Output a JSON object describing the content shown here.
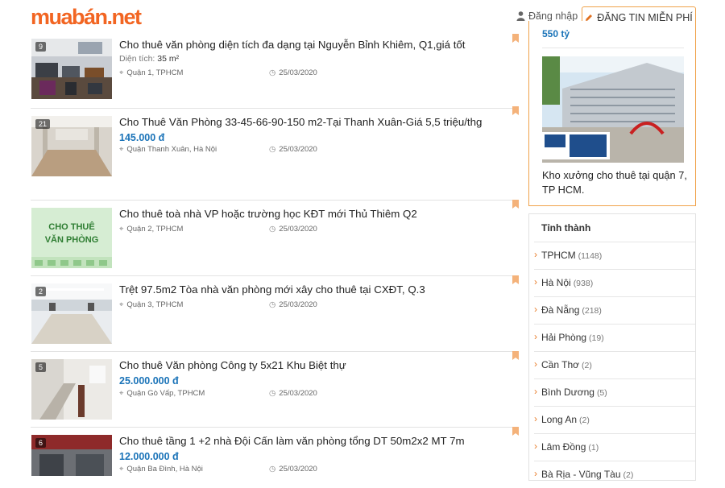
{
  "header": {
    "logo_main": "muabán",
    "logo_tld": ".net",
    "login_label": "Đăng nhập",
    "post_button_label": "ĐĂNG TIN MIỄN PHÍ"
  },
  "listings": [
    {
      "title": "Cho thuê văn phòng diện tích đa dạng tại Nguyễn Bỉnh Khiêm, Q1,giá tốt",
      "image_count": "9",
      "price": "",
      "area_label": "Diện tích:",
      "area_value": "35 m²",
      "location": "Quận 1, TPHCM",
      "date": "25/03/2020"
    },
    {
      "title": "Cho Thuê Văn Phòng 33-45-66-90-150 m2-Tại Thanh Xuân-Giá 5,5 triệu/thg",
      "image_count": "21",
      "price": "145.000 đ",
      "area_label": "",
      "area_value": "",
      "location": "Quận Thanh Xuân, Hà Nội",
      "date": "25/03/2020"
    },
    {
      "title": "Cho thuê toà nhà VP hoặc trường học KĐT mới Thủ Thiêm Q2",
      "image_count": "",
      "thumb_text": "CHO THUÊ\nVĂN PHÒNG",
      "price": "",
      "area_label": "",
      "area_value": "",
      "location": "Quận 2, TPHCM",
      "date": "25/03/2020"
    },
    {
      "title": "Trệt 97.5m2 Tòa nhà văn phòng mới xây cho thuê tại CXĐT, Q.3",
      "image_count": "2",
      "price": "",
      "area_label": "",
      "area_value": "",
      "location": "Quận 3, TPHCM",
      "date": "25/03/2020"
    },
    {
      "title": "Cho thuê Văn phòng Công ty 5x21 Khu Biệt thự",
      "image_count": "5",
      "price": "25.000.000 đ",
      "area_label": "",
      "area_value": "",
      "location": "Quận Gò Vấp, TPHCM",
      "date": "25/03/2020"
    },
    {
      "title": "Cho thuê tầng 1 +2 nhà Đội Cấn làm văn phòng tổng DT 50m2x2 MT 7m",
      "image_count": "6",
      "price": "12.000.000 đ",
      "area_label": "",
      "area_value": "",
      "location": "Quận Ba Đình, Hà Nội",
      "date": "25/03/2020"
    }
  ],
  "sidebar": {
    "ad_price": "550 tỷ",
    "ad_caption": "Kho xưởng cho thuê tại quận 7, TP HCM.",
    "provinces_heading": "Tỉnh thành",
    "provinces": [
      {
        "name": "TPHCM",
        "count": "(1148)"
      },
      {
        "name": "Hà Nội",
        "count": "(938)"
      },
      {
        "name": "Đà Nẵng",
        "count": "(218)"
      },
      {
        "name": "Hải Phòng",
        "count": "(19)"
      },
      {
        "name": "Cần Thơ",
        "count": "(2)"
      },
      {
        "name": "Bình Dương",
        "count": "(5)"
      },
      {
        "name": "Long An",
        "count": "(2)"
      },
      {
        "name": "Lâm Đồng",
        "count": "(1)"
      },
      {
        "name": "Bà Rịa - Vũng Tàu",
        "count": "(2)"
      }
    ]
  },
  "colors": {
    "brand": "#f26522",
    "price": "#1a73b8",
    "border_accent": "#f0a24a"
  }
}
